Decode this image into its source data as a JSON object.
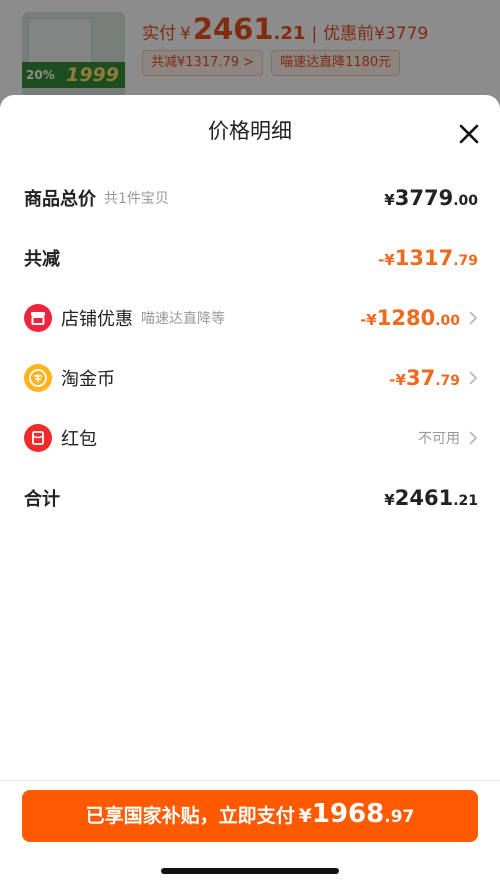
{
  "header": {
    "thumb_discount": "20%",
    "thumb_price": "1999",
    "pay_label": "实付",
    "pay_symbol": "¥",
    "pay_int": "2461",
    "pay_dec": ".21",
    "separator": "|",
    "orig_label": "优惠前¥3779",
    "chips": [
      "共减¥1317.79 >",
      "喵速达直降1180元"
    ]
  },
  "sheet": {
    "title": "价格明细",
    "rows": [
      {
        "label": "商品总价",
        "sub": "共1件宝贝",
        "sym": "¥",
        "int": "3779",
        "dec": ".00"
      },
      {
        "label": "共减",
        "sym": "-¥",
        "int": "1317",
        "dec": ".79"
      },
      {
        "label": "店铺优惠",
        "sub": "喵速达直降等",
        "icon": "store-icon",
        "sym": "-¥",
        "int": "1280",
        "dec": ".00"
      },
      {
        "label": "淘金币",
        "icon": "coin-icon",
        "sym": "-¥",
        "int": "37",
        "dec": ".79"
      },
      {
        "label": "红包",
        "icon": "red-packet-icon",
        "status": "不可用"
      },
      {
        "label": "合计",
        "sym": "¥",
        "int": "2461",
        "dec": ".21"
      }
    ]
  },
  "pay_button": {
    "text": "已享国家补贴，立即支付",
    "sym": "¥",
    "int": "1968",
    "dec": ".97"
  },
  "colors": {
    "accent": "#ff5a00",
    "discount": "#ee6a1f",
    "text": "#222222",
    "muted": "#999999"
  }
}
